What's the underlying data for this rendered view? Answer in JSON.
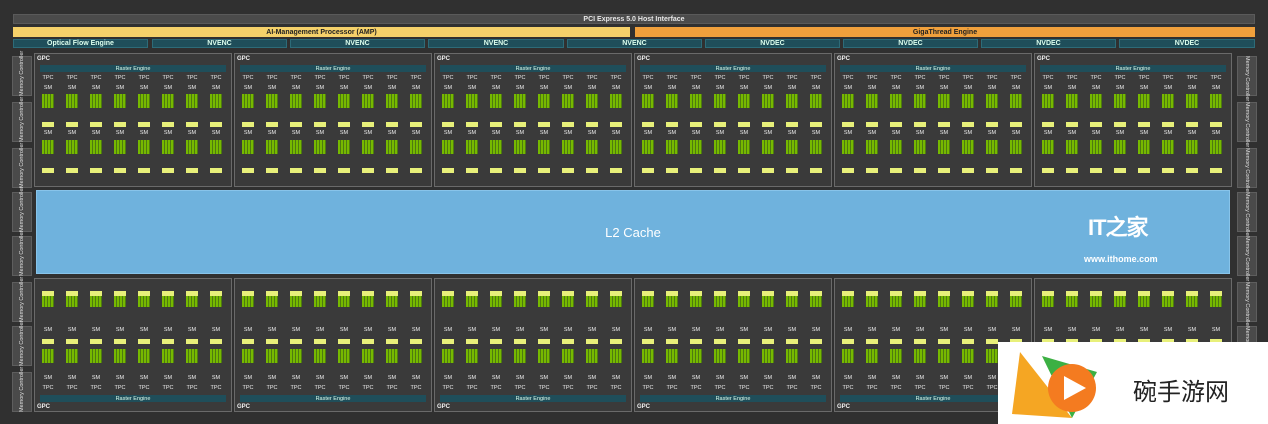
{
  "top": {
    "pcie": "PCI Express 5.0 Host Interface",
    "amp": "AI-Management Processor (AMP)",
    "gigathread": "GigaThread Engine"
  },
  "engines": [
    "Optical Flow Engine",
    "NVENC",
    "NVENC",
    "NVENC",
    "NVENC",
    "NVDEC",
    "NVDEC",
    "NVDEC",
    "NVDEC"
  ],
  "memory_controller_label": "Memory Controller",
  "gpc_label": "GPC",
  "raster_label": "Raster Engine",
  "tpc_label": "TPC",
  "sm_label": "SM",
  "l2_label": "L2 Cache",
  "watermark": {
    "logo": "IT之家",
    "url": "www.ithome.com"
  },
  "badge": {
    "text": "碗手游网"
  },
  "colors": {
    "sm_core": "#76b900",
    "l2": "#6fb2dd",
    "amp": "#f5d16a",
    "gigathread": "#f0a03c"
  }
}
